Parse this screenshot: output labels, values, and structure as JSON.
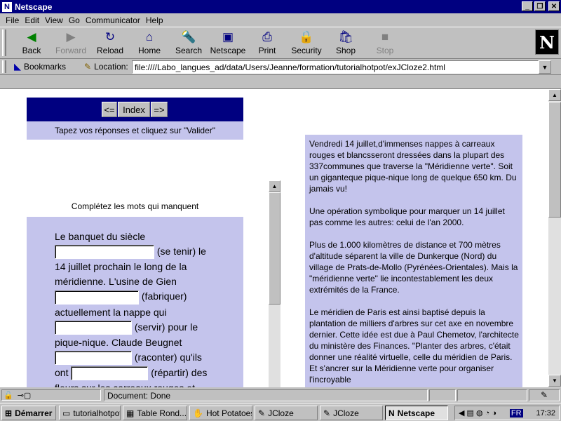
{
  "window": {
    "title": "Netscape",
    "controls": [
      "_",
      "❐",
      "✕"
    ]
  },
  "menu": [
    "File",
    "Edit",
    "View",
    "Go",
    "Communicator",
    "Help"
  ],
  "toolbar": {
    "buttons": [
      {
        "label": "Back",
        "icon": "back-arrow-icon",
        "glyph": "◀",
        "color": "#008000",
        "enabled": true
      },
      {
        "label": "Forward",
        "icon": "forward-arrow-icon",
        "glyph": "▶",
        "color": "#808080",
        "enabled": false
      },
      {
        "label": "Reload",
        "icon": "reload-icon",
        "glyph": "↻",
        "color": "#000080",
        "enabled": true
      },
      {
        "label": "Home",
        "icon": "home-icon",
        "glyph": "⌂",
        "color": "#000080",
        "enabled": true
      },
      {
        "label": "Search",
        "icon": "search-icon",
        "glyph": "🔦",
        "color": "#806000",
        "enabled": true
      },
      {
        "label": "Netscape",
        "icon": "netscape-icon",
        "glyph": "▣",
        "color": "#000080",
        "enabled": true
      },
      {
        "label": "Print",
        "icon": "print-icon",
        "glyph": "⎙",
        "color": "#000080",
        "enabled": true
      },
      {
        "label": "Security",
        "icon": "lock-icon",
        "glyph": "🔒",
        "color": "#a00000",
        "enabled": true
      },
      {
        "label": "Shop",
        "icon": "shop-icon",
        "glyph": "🛍",
        "color": "#000080",
        "enabled": true
      },
      {
        "label": "Stop",
        "icon": "stop-icon",
        "glyph": "■",
        "color": "#808080",
        "enabled": false
      }
    ],
    "logo": "N"
  },
  "location": {
    "bookmarks_label": "Bookmarks",
    "location_label": "Location:",
    "url": "file:////Labo_langues_ad/data/Users/Jeanne/formation/tutorialhotpot/exJCloze2.html"
  },
  "page": {
    "nav": {
      "prev": "<=",
      "index": "Index",
      "next": "=>"
    },
    "instructions": "Tapez vos réponses et cliquez sur \"Valider\"",
    "prompt": "Complétez les mots qui manquent",
    "exercise": {
      "t1": "Le banquet du siècle",
      "h1": "(se tenir) le 14 juillet prochain le long de la méridienne. L'usine de Gien",
      "h2": "(fabriquer) actuellement la nappe qui",
      "h3": "(servir) pour le pique-nique. Claude Beugnet",
      "h4": "(raconter) qu'ils ont",
      "h5": "(répartir) des fleurs sur les carreaux rouges et"
    },
    "reading": [
      "Vendredi 14 juillet,d'immenses nappes à carreaux rouges et blancsseront dressées dans la plupart des 337communes que traverse la \"Méridienne verte\". Soit un giganteque pique-nique long de quelque 650 km. Du jamais vu!",
      "Une opération symbolique pour marquer un 14 juillet pas comme les autres: celui de l'an 2000.",
      "Plus de 1.000 kilomètres de distance et 700 mètres d'altitude séparent la ville de Dunkerque (Nord) du village de Prats-de-Mollo (Pyrénées-Orientales). Mais la \"méridienne verte\" lie incontestablement les deux extrémités de la France.",
      "Le méridien de Paris est ainsi baptisé depuis la plantation de milliers d'arbres sur cet axe en novembre dernier. Cette idée est due à Paul Chemetov, l'architecte du ministère des Finances. \"Planter des arbres, c'était donner une réalité virtuelle, celle du méridien de Paris. Et s'ancrer sur la Méridienne verte pour organiser l'incroyable"
    ]
  },
  "status": {
    "text": "Document: Done"
  },
  "taskbar": {
    "start": "Démarrer",
    "tasks": [
      {
        "label": "tutorialhotpot",
        "icon": "folder-icon"
      },
      {
        "label": "Table Rond...",
        "icon": "table-icon"
      },
      {
        "label": "Hot Potatoes",
        "icon": "hotpotatoes-icon"
      },
      {
        "label": "JCloze",
        "icon": "jcloze-icon"
      },
      {
        "label": "JCloze",
        "icon": "jcloze-icon"
      },
      {
        "label": "Netscape",
        "icon": "netscape-icon"
      }
    ],
    "tray_lang": "FR",
    "clock": "17:32"
  }
}
